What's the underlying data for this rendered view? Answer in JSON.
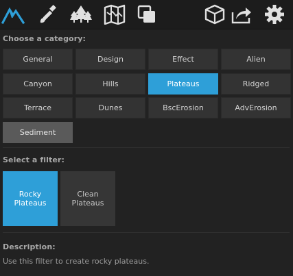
{
  "toolbar": {
    "icons": [
      {
        "name": "terrain-peak-icon",
        "active": true
      },
      {
        "name": "paint-brush-icon"
      },
      {
        "name": "forest-trees-icon"
      },
      {
        "name": "map-icon"
      },
      {
        "name": "layers-copy-icon"
      },
      {
        "name": "box-3d-icon"
      },
      {
        "name": "export-share-icon"
      },
      {
        "name": "settings-gear-icon"
      }
    ],
    "accent_color": "#2e9fd8",
    "icon_color": "#e0e0e0"
  },
  "category": {
    "label": "Choose a category:",
    "selected": "Plateaus",
    "highlighted": "Sediment",
    "items": [
      "General",
      "Design",
      "Effect",
      "Alien",
      "Canyon",
      "Hills",
      "Plateaus",
      "Ridged",
      "Terrace",
      "Dunes",
      "BscErosion",
      "AdvErosion",
      "Sediment"
    ]
  },
  "filter": {
    "label": "Select a filter:",
    "items": [
      {
        "label": "Rocky\nPlateaus",
        "selected": true
      },
      {
        "label": "Clean\nPlateaus",
        "selected": false
      }
    ]
  },
  "description": {
    "label": "Description:",
    "text": "Use this filter to create rocky plateaus."
  }
}
